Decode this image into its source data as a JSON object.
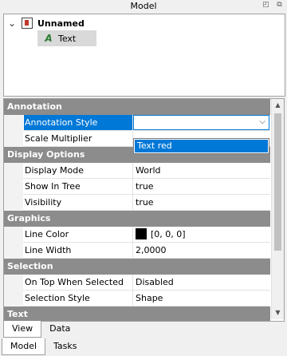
{
  "window": {
    "title": "Model"
  },
  "tree": {
    "root": {
      "label": "Unnamed",
      "expand_glyph": "❯"
    },
    "child": {
      "label": "Text",
      "icon": "A"
    }
  },
  "properties": {
    "groups": {
      "annotation": "Annotation",
      "display": "Display Options",
      "graphics": "Graphics",
      "selection": "Selection",
      "text": "Text"
    },
    "rows": {
      "annotation_style": {
        "name": "Annotation Style",
        "value": ""
      },
      "scale_multiplier": {
        "name": "Scale Multiplier",
        "value": ""
      },
      "display_mode": {
        "name": "Display Mode",
        "value": "World"
      },
      "show_in_tree": {
        "name": "Show In Tree",
        "value": "true"
      },
      "visibility": {
        "name": "Visibility",
        "value": "true"
      },
      "line_color": {
        "name": "Line Color",
        "value": "[0, 0, 0]",
        "swatch": "#000000"
      },
      "line_width": {
        "name": "Line Width",
        "value": "2,0000"
      },
      "on_top": {
        "name": "On Top When Selected",
        "value": "Disabled"
      },
      "selection_style": {
        "name": "Selection Style",
        "value": "Shape"
      }
    },
    "dropdown": {
      "options": [
        "Text red"
      ],
      "selected": "Text red"
    }
  },
  "tabs_inner": [
    "View",
    "Data"
  ],
  "tabs_outer": [
    "Model",
    "Tasks"
  ],
  "colors": {
    "accent": "#0078d7",
    "group_header": "#8c8c8c"
  }
}
